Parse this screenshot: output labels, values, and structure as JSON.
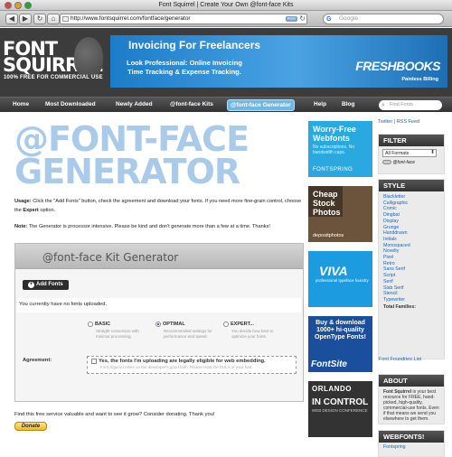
{
  "window": {
    "title": "Font Squirrel | Create Your Own @font-face Kits"
  },
  "browser": {
    "back": "◀",
    "forward": "▶",
    "reload": "↻",
    "home": "⌂",
    "rss": "RSS",
    "url": "http://www.fontsquirrel.com/fontface/generator",
    "search_placeholder": "Google"
  },
  "header": {
    "logo_line1": "FONT",
    "logo_line2": "SQUIRREL",
    "logo_tagline": "100% FREE FOR COMMERCIAL USE",
    "ad": {
      "headline": "Invoicing For Freelancers",
      "text1": "Look Professional: Online Invoicing",
      "text2": "Time Tracking & Expense Tracking.",
      "brand": "FRESHBOOKS",
      "brand_sub": "Painless Billing"
    }
  },
  "menu": {
    "items": [
      "Home",
      "Most Downloaded",
      "Newly Added",
      "@font-face Kits",
      "@font-face Generator",
      "Help",
      "Blog"
    ],
    "active": "@font-face Generator",
    "search_placeholder": "Find Fonts"
  },
  "main": {
    "title_line1": "@FONT-FACE",
    "title_line2": "GENERATOR",
    "usage_label": "Usage:",
    "usage_text": "Click the \"Add Fonts\" button, check the agreement and download your fonts. If you need more fine-grain control, choose the",
    "usage_expert": "Expert",
    "usage_end": "option.",
    "note_label": "Note:",
    "note_text": "The Generator is processor intensive. Please be kind and don't generate more than a few at a time. Thanks!",
    "kit": {
      "title": "@font-face Kit Generator",
      "add_fonts": "Add Fonts",
      "no_fonts": "You currently have no fonts uploaded.",
      "modes": [
        {
          "label": "BASIC",
          "desc": "Straight conversion with minimal processing.",
          "selected": false
        },
        {
          "label": "OPTIMAL",
          "desc": "Recommended settings for performance and speed.",
          "selected": true
        },
        {
          "label": "EXPERT...",
          "desc": "You decide how best to optimize your fonts.",
          "selected": false
        }
      ],
      "agreement_label": "Agreement:",
      "agreement_text": "Yes, the fonts I'm uploading are legally eligible for web embedding.",
      "agreement_sub": "Font Squirrel relies on the developer's good faith. Please read the EULA of your font."
    },
    "find_text": "Find this free service valuable and want to see it grow? Consider donating. Thank you!",
    "donate": "Donate"
  },
  "ads": {
    "fontspring_h": "Worry-Free Webfonts",
    "fontspring_s": "No subscriptions. No bandwidth caps.",
    "fontspring_brand": "FONTSPRING",
    "deposit_h": "Cheap Stock Photos",
    "deposit_brand": "depositphotos",
    "viva_h": "VIVA",
    "viva_s": "professional typeface foundry",
    "fontsite_h": "Buy & download 1000+ hi-quality OpenType Fonts!",
    "fontsite_brand": "FontSite",
    "orlando_h": "ORLANDO",
    "orlando_h2": "IN CONTROL",
    "orlando_s": "WEB DESIGN CONFERENCE"
  },
  "sidebar": {
    "twitter": "Twitter",
    "rss": "RSS Feed",
    "filter_title": "FILTER",
    "formats_selected": "All Formats",
    "fontface_label": "@font-face",
    "style_title": "STYLE",
    "styles": [
      "Blackletter",
      "Calligraphic",
      "Comic",
      "Dingbat",
      "Display",
      "Grunge",
      "Handdrawn",
      "Initials",
      "Monospaced",
      "Novelty",
      "Pixel",
      "Retro",
      "Sans Serif",
      "Script",
      "Serif",
      "Slab Serif",
      "Stencil",
      "Typewriter"
    ],
    "total_label": "Total Families:",
    "foundries": "Font Foundries List",
    "about_title": "ABOUT",
    "about_brand": "Font Squirrel",
    "about_text": "is your best resource for FREE, hand-picked, high-quality, commercial-use fonts. Even if that means we send you elsewhere to get them.",
    "webfonts_title": "WEBFONTS!",
    "webfonts_link": "Fontspring"
  },
  "colors": {
    "accent": "#a9cbe9",
    "header_bg": "#3c3c3c",
    "link": "#1a66b5",
    "active_tab": "#6fb8e5"
  }
}
